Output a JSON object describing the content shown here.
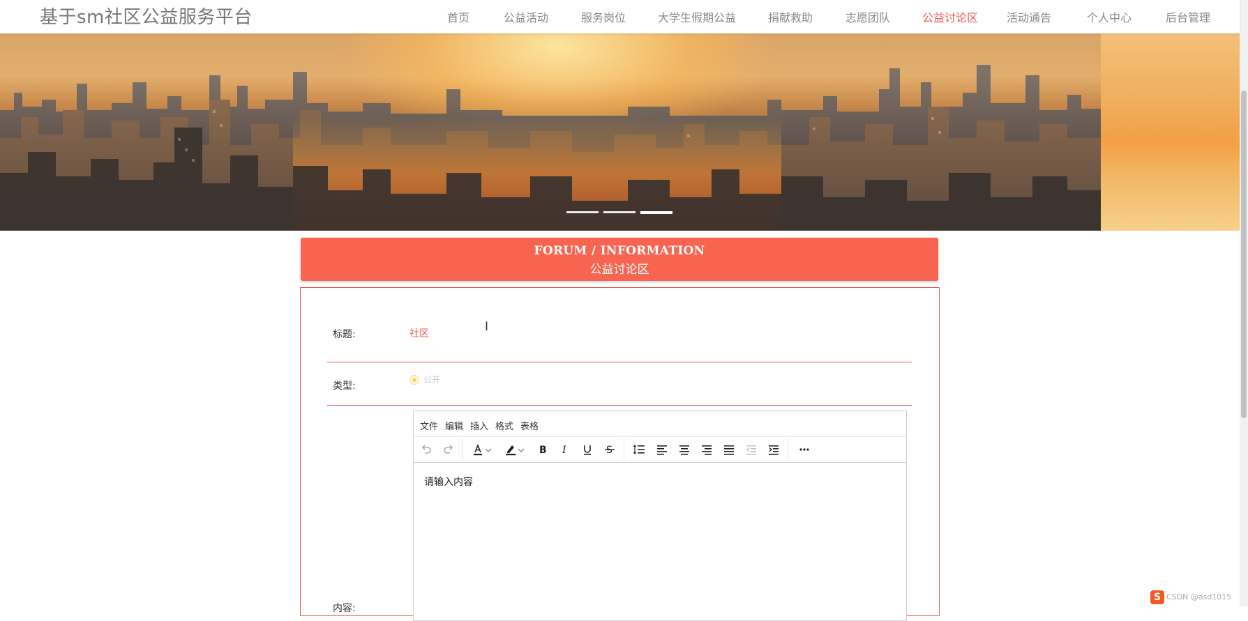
{
  "site": {
    "title": "基于sm社区公益服务平台"
  },
  "nav": {
    "items": [
      {
        "label": "首页"
      },
      {
        "label": "公益活动"
      },
      {
        "label": "服务岗位"
      },
      {
        "label": "大学生假期公益"
      },
      {
        "label": "捐献救助"
      },
      {
        "label": "志愿团队"
      },
      {
        "label": "公益讨论区"
      },
      {
        "label": "活动通告"
      },
      {
        "label": "个人中心"
      },
      {
        "label": "后台管理"
      }
    ],
    "active_index": 6
  },
  "banner": {
    "slide_count": 3,
    "active_slide": 3
  },
  "forum_header": {
    "title_en": "FORUM / INFORMATION",
    "title_cn": "公益讨论区"
  },
  "form": {
    "title_label": "标题:",
    "title_value": "社区",
    "type_label": "类型:",
    "type_option": "公开",
    "content_label": "内容:"
  },
  "editor": {
    "menus": [
      "文件",
      "编辑",
      "插入",
      "格式",
      "表格"
    ],
    "toolbar_icons": [
      "undo-icon",
      "redo-icon",
      "text-color-icon",
      "highlight-color-icon",
      "bold-icon",
      "italic-icon",
      "underline-icon",
      "strikethrough-icon",
      "line-height-icon",
      "align-left-icon",
      "align-center-icon",
      "align-right-icon",
      "align-justify-icon",
      "outdent-icon",
      "indent-icon",
      "more-icon"
    ],
    "placeholder": "请输入内容"
  },
  "tray": {
    "text": "CSDN @asd1015"
  },
  "colors": {
    "accent": "#ee5a52",
    "forum_header_bg": "#f96451"
  }
}
